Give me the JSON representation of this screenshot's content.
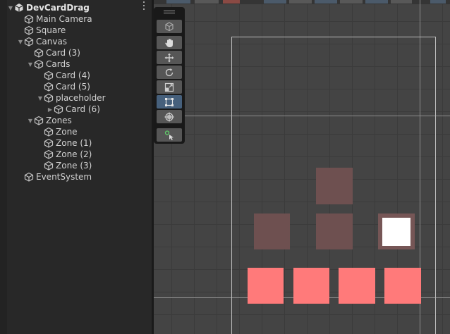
{
  "hierarchy": {
    "items": [
      {
        "label": "DevCardDrag",
        "depth": 0,
        "foldout": "expanded",
        "root": true
      },
      {
        "label": "Main Camera",
        "depth": 1,
        "foldout": "none"
      },
      {
        "label": "Square",
        "depth": 1,
        "foldout": "none"
      },
      {
        "label": "Canvas",
        "depth": 1,
        "foldout": "expanded"
      },
      {
        "label": "Card (3)",
        "depth": 2,
        "foldout": "none"
      },
      {
        "label": "Cards",
        "depth": 2,
        "foldout": "expanded"
      },
      {
        "label": "Card (4)",
        "depth": 3,
        "foldout": "none"
      },
      {
        "label": "Card (5)",
        "depth": 3,
        "foldout": "none"
      },
      {
        "label": "placeholder",
        "depth": 3,
        "foldout": "expanded"
      },
      {
        "label": "Card (6)",
        "depth": 4,
        "foldout": "collapsed"
      },
      {
        "label": "Zones",
        "depth": 2,
        "foldout": "expanded"
      },
      {
        "label": "Zone",
        "depth": 3,
        "foldout": "none"
      },
      {
        "label": "Zone (1)",
        "depth": 3,
        "foldout": "none"
      },
      {
        "label": "Zone (2)",
        "depth": 3,
        "foldout": "none"
      },
      {
        "label": "Zone (3)",
        "depth": 3,
        "foldout": "none"
      },
      {
        "label": "EventSystem",
        "depth": 1,
        "foldout": "none"
      }
    ]
  },
  "tools": {
    "items": [
      {
        "name": "view-options",
        "icon": "cube-icon",
        "active": false
      },
      {
        "name": "hand-tool",
        "icon": "hand-icon",
        "active": false
      },
      {
        "name": "move-tool",
        "icon": "move-arrows-icon",
        "active": false
      },
      {
        "name": "rotate-tool",
        "icon": "rotate-icon",
        "active": false
      },
      {
        "name": "scale-tool",
        "icon": "scale-icon",
        "active": false
      },
      {
        "name": "rect-tool",
        "icon": "rect-transform-icon",
        "active": true
      },
      {
        "name": "transform-tool",
        "icon": "transform-icon",
        "active": false
      },
      {
        "name": "custom-tool",
        "icon": "custom-tool-icon",
        "active": false
      }
    ]
  },
  "colors": {
    "slot": "#6e5050",
    "card": "#ff7a7a",
    "active_tool": "#46607c"
  }
}
